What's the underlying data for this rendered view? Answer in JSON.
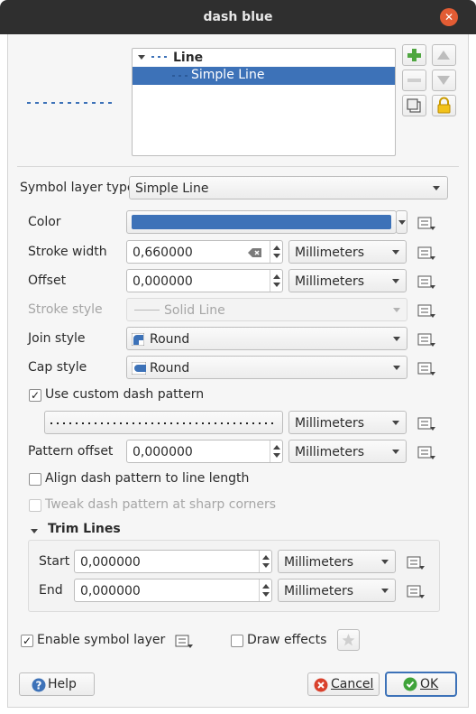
{
  "window": {
    "title": "dash blue"
  },
  "tree": {
    "root_label": "Line",
    "child_label": "Simple Line"
  },
  "symbol_layer_type": {
    "label": "Symbol layer type",
    "value": "Simple Line"
  },
  "fields": {
    "color_label": "Color",
    "color_value": "#3d72b8",
    "stroke_width_label": "Stroke width",
    "stroke_width_value": "0,660000",
    "stroke_width_unit": "Millimeters",
    "offset_label": "Offset",
    "offset_value": "0,000000",
    "offset_unit": "Millimeters",
    "stroke_style_label": "Stroke style",
    "stroke_style_value": "Solid Line",
    "join_style_label": "Join style",
    "join_style_value": "Round",
    "cap_style_label": "Cap style",
    "cap_style_value": "Round"
  },
  "dash": {
    "custom_pattern_label": "Use custom dash pattern",
    "custom_pattern_checked": true,
    "pattern_unit": "Millimeters",
    "pattern_offset_label": "Pattern offset",
    "pattern_offset_value": "0,000000",
    "pattern_offset_unit": "Millimeters",
    "align_label": "Align dash pattern to line length",
    "align_checked": false,
    "tweak_label": "Tweak dash pattern at sharp corners",
    "tweak_checked": false
  },
  "trim": {
    "title": "Trim Lines",
    "start_label": "Start",
    "start_value": "0,000000",
    "start_unit": "Millimeters",
    "end_label": "End",
    "end_value": "0,000000",
    "end_unit": "Millimeters"
  },
  "bottom": {
    "enable_label": "Enable symbol layer",
    "enable_checked": true,
    "effects_label": "Draw effects",
    "effects_checked": false
  },
  "buttons": {
    "help": "Help",
    "cancel": "Cancel",
    "ok": "OK"
  },
  "colors": {
    "titlebar": "#2f2f2f",
    "selection": "#3d72b8",
    "close": "#e25c34",
    "ok_border": "#3d72b8"
  }
}
